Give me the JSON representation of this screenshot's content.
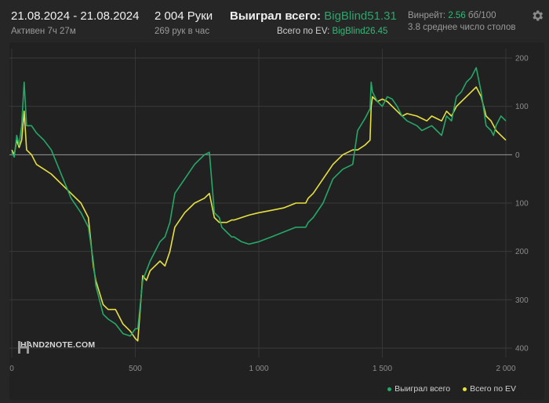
{
  "header": {
    "date_range": "21.08.2024 - 21.08.2024",
    "active": "Активен 7ч 27м",
    "hands": "2 004 Руки",
    "hands_rate": "269 рук в час",
    "won_label": "Выиграл всего:",
    "won_value": "BigBlind51.31",
    "ev_label": "Всего по EV:",
    "ev_value": "BigBlind26.45",
    "winrate_label": "Винрейт:",
    "winrate_value": "2.56",
    "winrate_hands": "бб/100",
    "tables": "3.8 среднее число столов"
  },
  "watermark": {
    "text": "HAND2NOTE.COM"
  },
  "legend": [
    {
      "name": "Выиграл всего",
      "color": "#25a868"
    },
    {
      "name": "Всего по EV",
      "color": "#e6e040"
    }
  ],
  "colors": {
    "accent": "#2ea36b",
    "won": "#25a868",
    "ev": "#e6e040",
    "background": "#262626"
  },
  "chart_data": {
    "type": "line",
    "xlim": [
      0,
      2000
    ],
    "ylim": [
      -400,
      200
    ],
    "x_ticks": [
      {
        "value": 0,
        "label": "0"
      },
      {
        "value": 500,
        "label": "500"
      },
      {
        "value": 1000,
        "label": "1 000"
      },
      {
        "value": 1500,
        "label": "1 500"
      },
      {
        "value": 2000,
        "label": "2 000"
      }
    ],
    "y_ticks": [
      {
        "value": 200,
        "label": "200"
      },
      {
        "value": 100,
        "label": "100"
      },
      {
        "value": 0,
        "label": "0"
      },
      {
        "value": -100,
        "label": "100"
      },
      {
        "value": -200,
        "label": "200"
      },
      {
        "value": -300,
        "label": "300"
      },
      {
        "value": -400,
        "label": "400"
      }
    ],
    "grid": true,
    "legend_position": "bottom-right",
    "series": [
      {
        "name": "Выиграл всего",
        "color": "#25a868",
        "x": [
          0,
          10,
          20,
          30,
          40,
          50,
          60,
          80,
          100,
          130,
          160,
          200,
          240,
          280,
          310,
          330,
          340,
          370,
          390,
          420,
          450,
          480,
          500,
          510,
          530,
          545,
          560,
          580,
          600,
          620,
          640,
          660,
          700,
          740,
          780,
          800,
          820,
          840,
          850,
          870,
          890,
          900,
          930,
          960,
          1000,
          1050,
          1100,
          1150,
          1190,
          1200,
          1220,
          1260,
          1300,
          1340,
          1380,
          1400,
          1430,
          1450,
          1455,
          1460,
          1480,
          1500,
          1520,
          1540,
          1560,
          1580,
          1600,
          1640,
          1660,
          1680,
          1700,
          1720,
          1740,
          1760,
          1780,
          1800,
          1820,
          1840,
          1860,
          1880,
          1900,
          1920,
          1940,
          1950,
          1960,
          1980,
          2000
        ],
        "y": [
          5,
          -5,
          40,
          20,
          60,
          150,
          60,
          60,
          45,
          30,
          10,
          -40,
          -90,
          -120,
          -150,
          -220,
          -270,
          -330,
          -340,
          -350,
          -370,
          -375,
          -360,
          -360,
          -260,
          -240,
          -220,
          -200,
          -180,
          -170,
          -140,
          -80,
          -50,
          -20,
          0,
          5,
          -120,
          -130,
          -150,
          -160,
          -170,
          -170,
          -180,
          -185,
          -180,
          -170,
          -160,
          -150,
          -150,
          -140,
          -130,
          -100,
          -50,
          -30,
          -20,
          50,
          75,
          95,
          150,
          130,
          110,
          100,
          120,
          115,
          100,
          80,
          70,
          60,
          50,
          55,
          60,
          50,
          40,
          80,
          70,
          120,
          130,
          150,
          160,
          180,
          130,
          60,
          50,
          40,
          60,
          80,
          70
        ]
      },
      {
        "name": "Всего по EV",
        "color": "#e6e040",
        "x": [
          0,
          10,
          20,
          30,
          40,
          50,
          60,
          80,
          100,
          130,
          160,
          200,
          240,
          280,
          310,
          330,
          340,
          370,
          390,
          420,
          450,
          480,
          500,
          510,
          530,
          545,
          560,
          580,
          600,
          620,
          640,
          660,
          700,
          740,
          780,
          800,
          820,
          840,
          850,
          870,
          890,
          900,
          930,
          960,
          1000,
          1050,
          1100,
          1150,
          1190,
          1200,
          1220,
          1260,
          1300,
          1340,
          1380,
          1400,
          1430,
          1450,
          1455,
          1460,
          1480,
          1500,
          1520,
          1540,
          1560,
          1580,
          1600,
          1640,
          1660,
          1680,
          1700,
          1720,
          1740,
          1760,
          1780,
          1800,
          1820,
          1840,
          1860,
          1880,
          1900,
          1920,
          1940,
          1950,
          1960,
          1980,
          2000
        ],
        "y": [
          10,
          0,
          30,
          15,
          30,
          90,
          10,
          0,
          -20,
          -30,
          -40,
          -60,
          -80,
          -100,
          -130,
          -230,
          -260,
          -310,
          -320,
          -320,
          -350,
          -365,
          -380,
          -385,
          -250,
          -260,
          -240,
          -230,
          -220,
          -230,
          -200,
          -150,
          -120,
          -100,
          -90,
          -80,
          -130,
          -140,
          -140,
          -140,
          -135,
          -135,
          -130,
          -125,
          -120,
          -115,
          -110,
          -100,
          -100,
          -90,
          -80,
          -50,
          -20,
          0,
          10,
          10,
          20,
          30,
          100,
          120,
          110,
          115,
          110,
          100,
          90,
          80,
          85,
          80,
          75,
          70,
          80,
          75,
          70,
          90,
          80,
          100,
          110,
          120,
          130,
          140,
          120,
          80,
          70,
          60,
          50,
          40,
          30
        ]
      }
    ]
  }
}
